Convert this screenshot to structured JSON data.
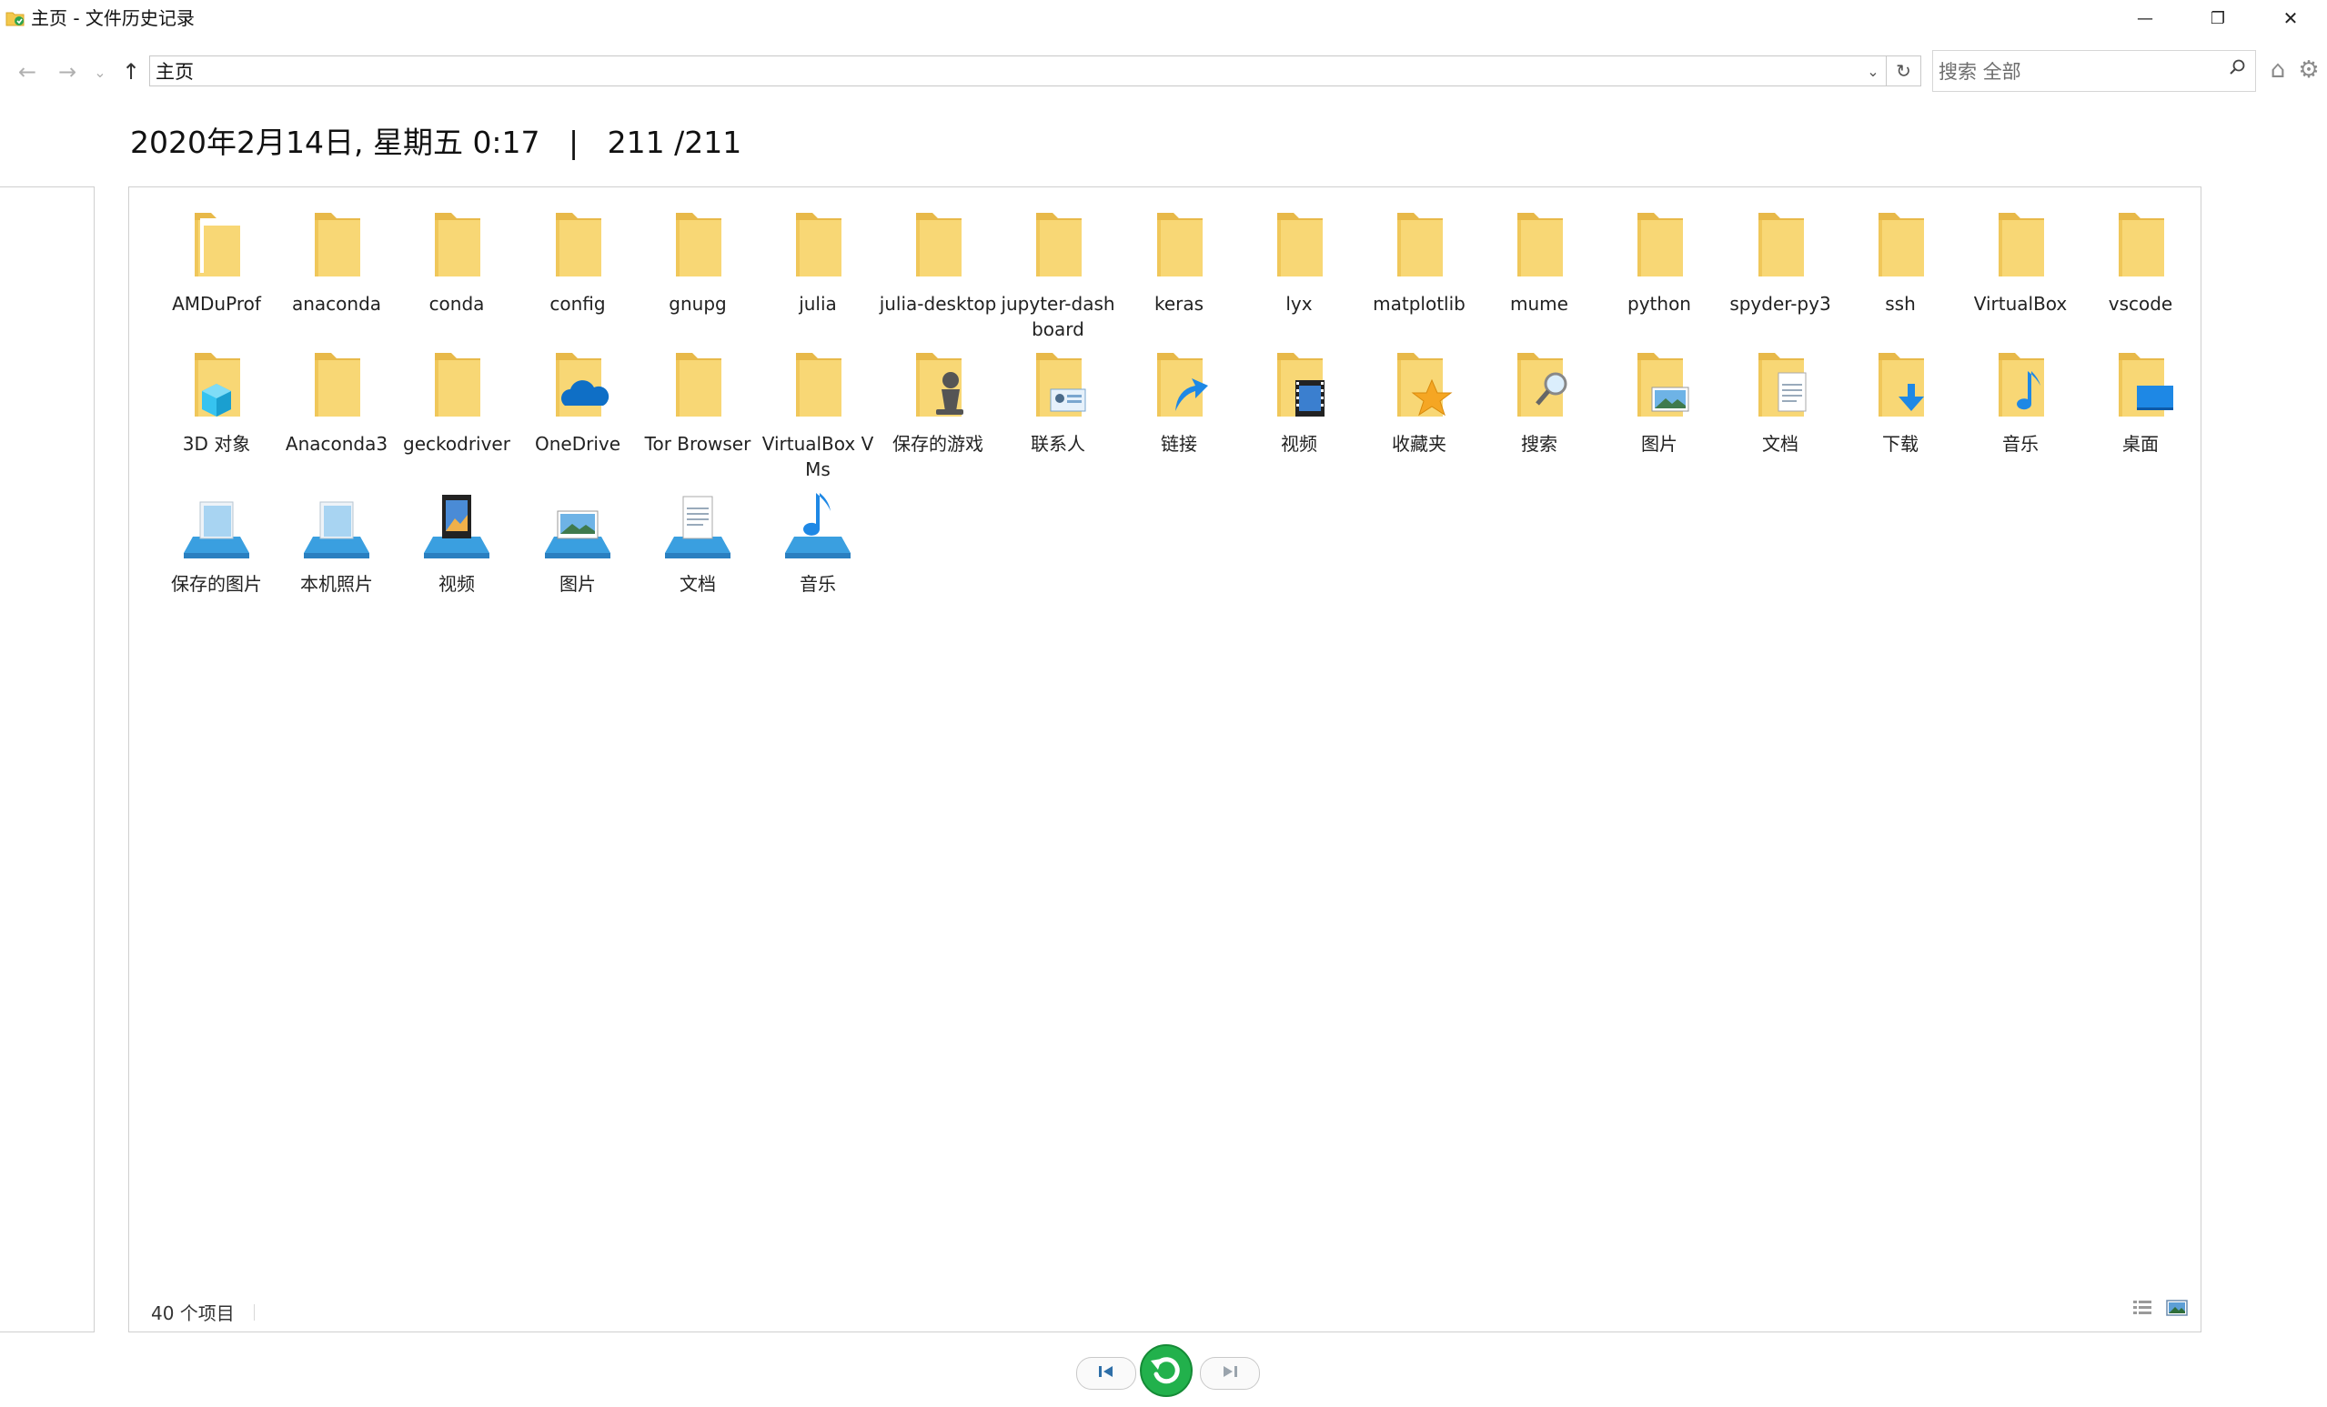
{
  "window": {
    "title": "主页 - 文件历史记录",
    "minimize_glyph": "—",
    "restore_glyph": "❐",
    "close_glyph": "✕"
  },
  "nav": {
    "back_glyph": "←",
    "forward_glyph": "→",
    "recent_glyph": "⌄",
    "up_glyph": "↑",
    "address_value": "主页",
    "dropdown_glyph": "⌄",
    "refresh_glyph": "↻",
    "search_placeholder": "搜索 全部",
    "search_glyph": "⚲",
    "home_glyph": "⌂",
    "settings_glyph": "⚙"
  },
  "heading": {
    "date": "2020年2月14日, 星期五 0:17",
    "separator": "|",
    "version": "211 /211"
  },
  "items": [
    {
      "label": "AMDuProf",
      "icon": "folder-open-icon"
    },
    {
      "label": "anaconda",
      "icon": "folder-icon"
    },
    {
      "label": "conda",
      "icon": "folder-icon"
    },
    {
      "label": "config",
      "icon": "folder-icon"
    },
    {
      "label": "gnupg",
      "icon": "folder-icon"
    },
    {
      "label": "julia",
      "icon": "folder-icon"
    },
    {
      "label": "julia-desktop",
      "icon": "folder-icon"
    },
    {
      "label": "jupyter-dashboard",
      "icon": "folder-icon"
    },
    {
      "label": "keras",
      "icon": "folder-icon"
    },
    {
      "label": "lyx",
      "icon": "folder-icon"
    },
    {
      "label": "matplotlib",
      "icon": "folder-icon"
    },
    {
      "label": "mume",
      "icon": "folder-icon"
    },
    {
      "label": "python",
      "icon": "folder-icon"
    },
    {
      "label": "spyder-py3",
      "icon": "folder-icon"
    },
    {
      "label": "ssh",
      "icon": "folder-icon"
    },
    {
      "label": "VirtualBox",
      "icon": "folder-icon"
    },
    {
      "label": "vscode",
      "icon": "folder-icon"
    },
    {
      "label": "3D 对象",
      "icon": "3d-objects-folder-icon"
    },
    {
      "label": "Anaconda3",
      "icon": "folder-icon"
    },
    {
      "label": "geckodriver",
      "icon": "folder-icon"
    },
    {
      "label": "OneDrive",
      "icon": "onedrive-folder-icon"
    },
    {
      "label": "Tor Browser",
      "icon": "folder-icon"
    },
    {
      "label": "VirtualBox VMs",
      "icon": "folder-icon"
    },
    {
      "label": "保存的游戏",
      "icon": "saved-games-folder-icon"
    },
    {
      "label": "联系人",
      "icon": "contacts-folder-icon"
    },
    {
      "label": "链接",
      "icon": "links-folder-icon"
    },
    {
      "label": "视频",
      "icon": "videos-folder-icon"
    },
    {
      "label": "收藏夹",
      "icon": "favorites-folder-icon"
    },
    {
      "label": "搜索",
      "icon": "searches-folder-icon"
    },
    {
      "label": "图片",
      "icon": "pictures-folder-icon"
    },
    {
      "label": "文档",
      "icon": "documents-folder-icon"
    },
    {
      "label": "下载",
      "icon": "downloads-folder-icon"
    },
    {
      "label": "音乐",
      "icon": "music-folder-icon"
    },
    {
      "label": "桌面",
      "icon": "desktop-folder-icon"
    },
    {
      "label": "保存的图片",
      "icon": "saved-pictures-library-icon"
    },
    {
      "label": "本机照片",
      "icon": "camera-roll-library-icon"
    },
    {
      "label": "视频",
      "icon": "videos-library-icon"
    },
    {
      "label": "图片",
      "icon": "pictures-library-icon"
    },
    {
      "label": "文档",
      "icon": "documents-library-icon"
    },
    {
      "label": "音乐",
      "icon": "music-library-icon"
    }
  ],
  "status": {
    "count": "40 个项目"
  },
  "colors": {
    "folder_body": "#f8d775",
    "folder_back": "#e8b949",
    "accent_blue": "#1e88e5",
    "restore_green": "#22b14c"
  }
}
